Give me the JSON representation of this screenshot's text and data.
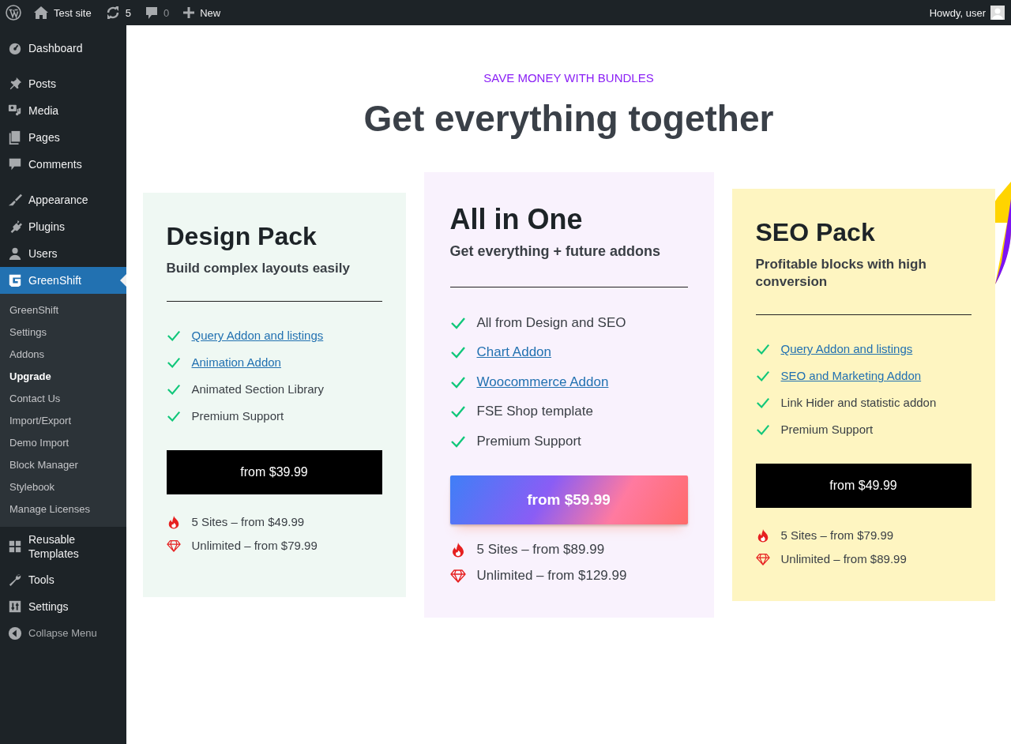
{
  "admin_bar": {
    "site": "Test site",
    "updates": "5",
    "comments": "0",
    "new": "New",
    "greeting": "Howdy, user"
  },
  "sidebar": {
    "items": [
      {
        "label": "Dashboard",
        "selected": false
      },
      {
        "label": "Posts",
        "selected": false
      },
      {
        "label": "Media",
        "selected": false
      },
      {
        "label": "Pages",
        "selected": false
      },
      {
        "label": "Comments",
        "selected": false
      },
      {
        "label": "Appearance",
        "selected": false
      },
      {
        "label": "Plugins",
        "selected": false
      },
      {
        "label": "Users",
        "selected": false
      },
      {
        "label": "GreenShift",
        "selected": true,
        "children": [
          {
            "label": "GreenShift",
            "selected": false
          },
          {
            "label": "Settings",
            "selected": false
          },
          {
            "label": "Addons",
            "selected": false
          },
          {
            "label": "Upgrade",
            "selected": true
          },
          {
            "label": "Contact Us",
            "selected": false
          },
          {
            "label": "Import/Export",
            "selected": false
          },
          {
            "label": "Demo Import",
            "selected": false
          },
          {
            "label": "Block Manager",
            "selected": false
          },
          {
            "label": "Stylebook",
            "selected": false
          },
          {
            "label": "Manage Licenses",
            "selected": false
          }
        ]
      },
      {
        "label": "Reusable Templates",
        "selected": false
      },
      {
        "label": "Tools",
        "selected": false
      },
      {
        "label": "Settings",
        "selected": false
      }
    ],
    "collapse": "Collapse Menu"
  },
  "pricing": {
    "kicker": "SAVE MONEY WITH BUNDLES",
    "heading": "Get everything together",
    "plans": [
      {
        "title": "Design Pack",
        "subtitle": "Build complex layouts easily",
        "featured": false,
        "color": "#eff8f3",
        "features": [
          {
            "text": "Query Addon and listings",
            "link": true
          },
          {
            "text": "Animation Addon",
            "link": true
          },
          {
            "text": "Animated Section Library",
            "link": false
          },
          {
            "text": "Premium Support",
            "link": false
          }
        ],
        "button": "from $39.99",
        "tiers": [
          {
            "kind": "sites",
            "text": "5 Sites – from $49.99"
          },
          {
            "kind": "unlimited",
            "text": "Unlimited – from $79.99"
          }
        ]
      },
      {
        "title": "All in One",
        "subtitle": "Get everything + future addons",
        "featured": true,
        "color": "#f9f2fd",
        "features": [
          {
            "text": "All from Design and SEO",
            "link": false
          },
          {
            "text": "Chart Addon",
            "link": true
          },
          {
            "text": "Woocommerce Addon",
            "link": true
          },
          {
            "text": "FSE Shop template",
            "link": false
          },
          {
            "text": "Premium Support",
            "link": false
          }
        ],
        "button": "from $59.99",
        "tiers": [
          {
            "kind": "sites",
            "text": "5 Sites – from $89.99"
          },
          {
            "kind": "unlimited",
            "text": "Unlimited – from $129.99"
          }
        ]
      },
      {
        "title": "SEO Pack",
        "subtitle": "Profitable blocks with high conversion",
        "featured": false,
        "color": "#fef5c1",
        "features": [
          {
            "text": "Query Addon and listings",
            "link": true
          },
          {
            "text": "SEO and Marketing Addon",
            "link": true
          },
          {
            "text": "Link Hider and statistic addon",
            "link": false
          },
          {
            "text": "Premium Support",
            "link": false
          }
        ],
        "button": "from $49.99",
        "tiers": [
          {
            "kind": "sites",
            "text": "5 Sites – from $79.99"
          },
          {
            "kind": "unlimited",
            "text": "Unlimited – from $89.99"
          }
        ]
      }
    ]
  }
}
